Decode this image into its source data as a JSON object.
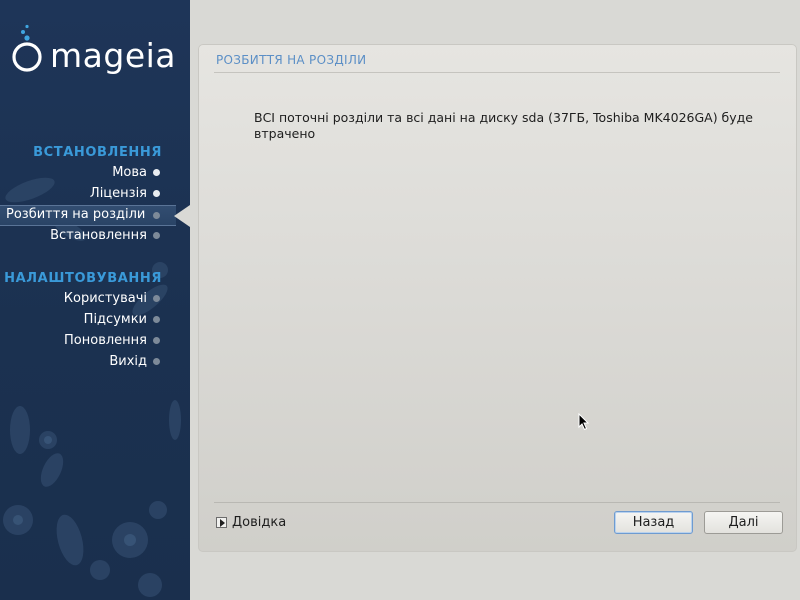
{
  "sidebar": {
    "logo_text": "mageia",
    "sections": [
      {
        "title": "ВСТАНОВЛЕННЯ",
        "steps": [
          {
            "label": "Мова",
            "state": "done"
          },
          {
            "label": "Ліцензія",
            "state": "done"
          },
          {
            "label": "Розбиття на розділи",
            "state": "active"
          },
          {
            "label": "Встановлення",
            "state": "todo"
          }
        ]
      },
      {
        "title": "НАЛАШТОВУВАННЯ",
        "steps": [
          {
            "label": "Користувачі",
            "state": "todo"
          },
          {
            "label": "Підсумки",
            "state": "todo"
          },
          {
            "label": "Поновлення",
            "state": "todo"
          },
          {
            "label": "Вихід",
            "state": "todo"
          }
        ]
      }
    ]
  },
  "main": {
    "title": "РОЗБИТТЯ НА РОЗДІЛИ",
    "message": "ВСІ поточні розділи та всі дані на диску sda (37ГБ, Toshiba MK4026GA) буде втрачено",
    "help_label": "Довідка",
    "back_label": "Назад",
    "next_label": "Далі"
  },
  "colors": {
    "sidebar_bg": "#1e3558",
    "section_title": "#3a9ad9",
    "panel_title": "#5c8fc6"
  }
}
